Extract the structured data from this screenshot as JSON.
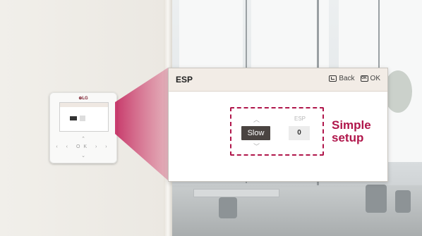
{
  "panel": {
    "title": "ESP",
    "back_label": "Back",
    "ok_label": "OK",
    "ok_icon_text": "OK"
  },
  "control": {
    "mode_value": "Slow",
    "esp_label": "ESP",
    "esp_value": "0"
  },
  "callout": {
    "line1": "Simple",
    "line2": "setup"
  },
  "device": {
    "logo": "⊕LG",
    "keys": "‹ ‹ OK › ›"
  },
  "colors": {
    "accent": "#b0164b",
    "header_bg": "#f2ece6",
    "button_dark": "#4a4441"
  }
}
